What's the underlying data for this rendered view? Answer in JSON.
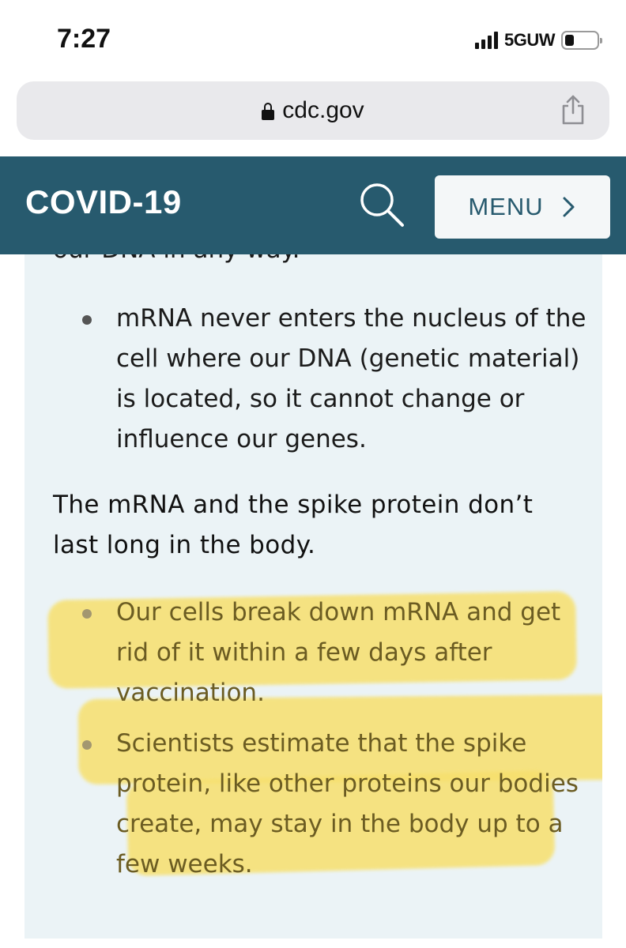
{
  "status_bar": {
    "time": "7:27",
    "network": "5GUW",
    "icons": [
      "signal-icon",
      "battery-icon"
    ]
  },
  "browser": {
    "url": "cdc.gov",
    "icons": [
      "lock-icon",
      "share-icon"
    ]
  },
  "site_header": {
    "title": "COVID-19",
    "menu_label": "MENU",
    "icons": [
      "search-icon",
      "chevron-right-icon"
    ],
    "color": "#275a6e"
  },
  "content": {
    "cut_off_text": "our DNA in any way.",
    "list_1": [
      "mRNA never enters the nucleus of the cell where our DNA (genetic material) is located, so it cannot change or influence our genes."
    ],
    "subheading": "The mRNA and the spike protein don’t last long in the body.",
    "list_2": [
      "Our cells break down mRNA and get rid of it within a few days after vaccination.",
      "Scientists estimate that the spike protein, like other proteins our bodies create, may stay in the body up to a few weeks."
    ],
    "highlight_color": "#f7e06d"
  }
}
